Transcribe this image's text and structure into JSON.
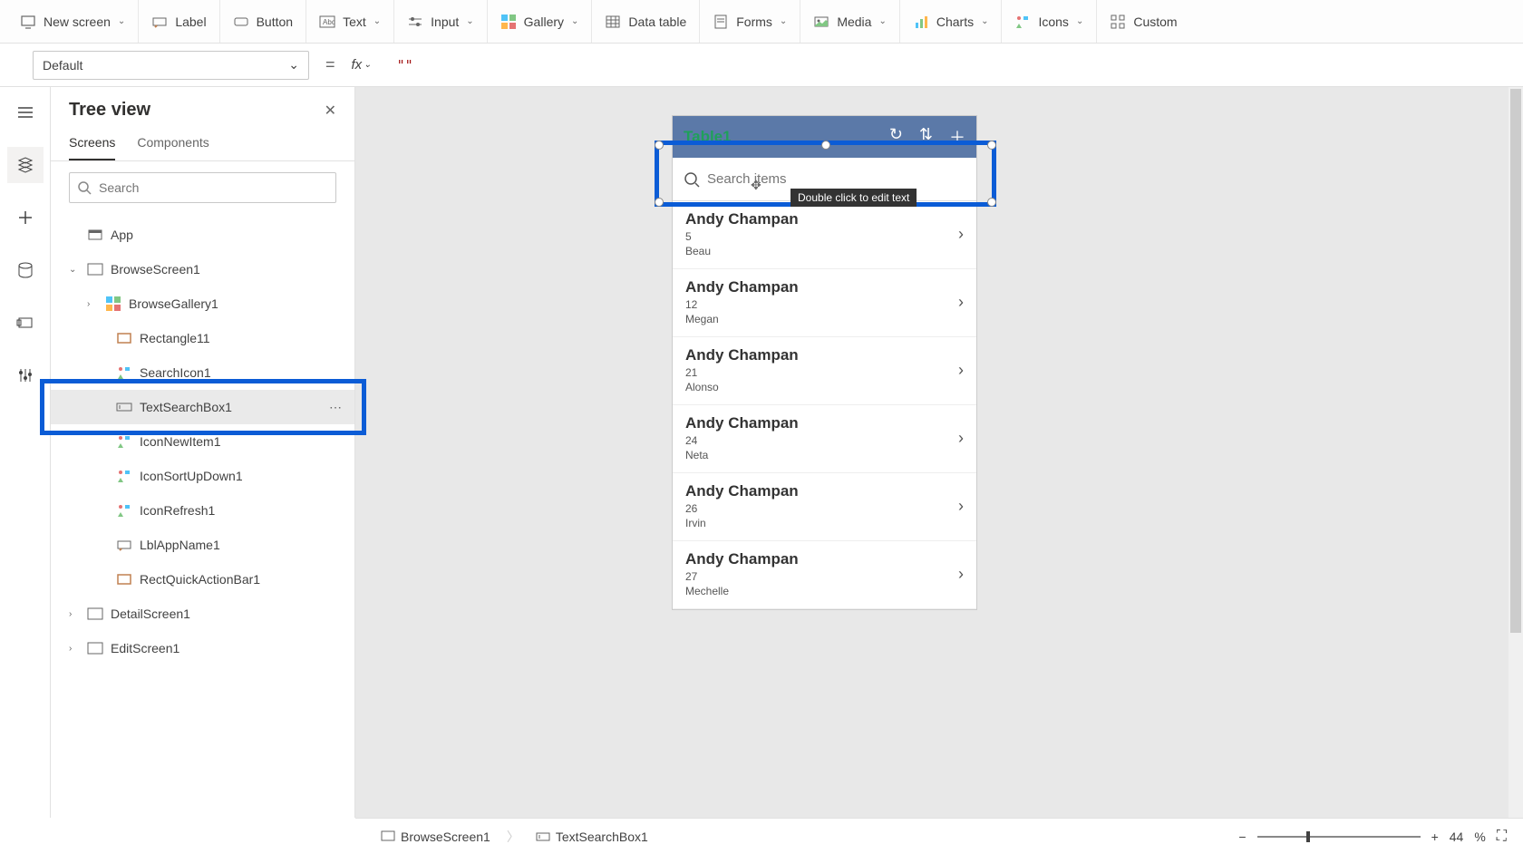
{
  "ribbon": {
    "items": [
      {
        "label": "New screen"
      },
      {
        "label": "Label"
      },
      {
        "label": "Button"
      },
      {
        "label": "Text"
      },
      {
        "label": "Input"
      },
      {
        "label": "Gallery"
      },
      {
        "label": "Data table"
      },
      {
        "label": "Forms"
      },
      {
        "label": "Media"
      },
      {
        "label": "Charts"
      },
      {
        "label": "Icons"
      },
      {
        "label": "Custom"
      }
    ]
  },
  "formula": {
    "property": "Default",
    "value": "\"\""
  },
  "tree": {
    "title": "Tree view",
    "tabs": {
      "screens": "Screens",
      "components": "Components"
    },
    "search_placeholder": "Search",
    "items": [
      {
        "label": "App",
        "indent": 0,
        "type": "app"
      },
      {
        "label": "BrowseScreen1",
        "indent": 0,
        "type": "screen",
        "expanded": true
      },
      {
        "label": "BrowseGallery1",
        "indent": 1,
        "type": "gallery",
        "expandable": true
      },
      {
        "label": "Rectangle11",
        "indent": 2,
        "type": "rect"
      },
      {
        "label": "SearchIcon1",
        "indent": 2,
        "type": "icon"
      },
      {
        "label": "TextSearchBox1",
        "indent": 2,
        "type": "input",
        "selected": true
      },
      {
        "label": "IconNewItem1",
        "indent": 2,
        "type": "icon"
      },
      {
        "label": "IconSortUpDown1",
        "indent": 2,
        "type": "icon"
      },
      {
        "label": "IconRefresh1",
        "indent": 2,
        "type": "icon"
      },
      {
        "label": "LblAppName1",
        "indent": 2,
        "type": "label"
      },
      {
        "label": "RectQuickActionBar1",
        "indent": 2,
        "type": "rect"
      },
      {
        "label": "DetailScreen1",
        "indent": 0,
        "type": "screen",
        "expandable": true
      },
      {
        "label": "EditScreen1",
        "indent": 0,
        "type": "screen",
        "expandable": true
      }
    ]
  },
  "canvas": {
    "app_title": "Table1",
    "search_placeholder": "Search items",
    "tooltip": "Double click to edit text",
    "rows": [
      {
        "name": "Andy Champan",
        "val": "5",
        "sub": "Beau"
      },
      {
        "name": "Andy Champan",
        "val": "12",
        "sub": "Megan"
      },
      {
        "name": "Andy Champan",
        "val": "21",
        "sub": "Alonso"
      },
      {
        "name": "Andy Champan",
        "val": "24",
        "sub": "Neta"
      },
      {
        "name": "Andy Champan",
        "val": "26",
        "sub": "Irvin"
      },
      {
        "name": "Andy Champan",
        "val": "27",
        "sub": "Mechelle"
      }
    ]
  },
  "breadcrumb": {
    "screen": "BrowseScreen1",
    "control": "TextSearchBox1"
  },
  "zoom": {
    "value": "44",
    "unit": "%"
  }
}
